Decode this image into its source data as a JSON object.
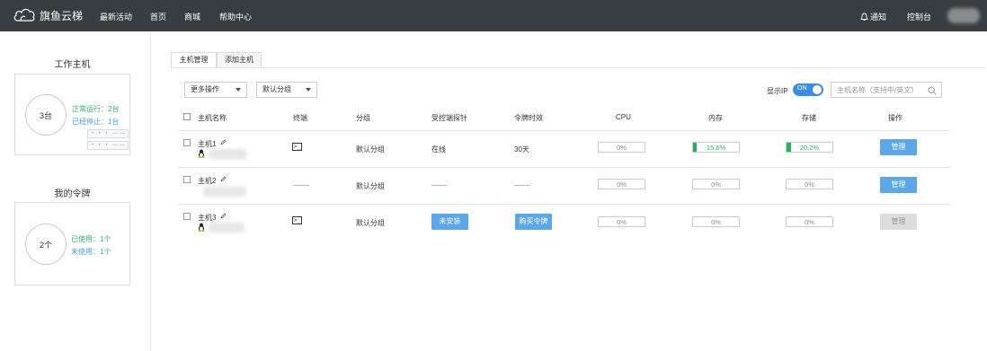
{
  "topbar": {
    "brand": "旗鱼云梯",
    "nav": [
      "最新活动",
      "首页",
      "商城",
      "帮助中心"
    ],
    "notice": "通知",
    "console": "控制台"
  },
  "sidebar": {
    "hosts": {
      "title": "工作主机",
      "count": "3台",
      "running": "正常运行：2台",
      "stopped": "已经停止：1台"
    },
    "tokens": {
      "title": "我的令牌",
      "count": "2个",
      "used": "已使用：1个",
      "unused": "未使用：1个"
    }
  },
  "tabs": [
    "主机管理",
    "添加主机"
  ],
  "toolbar": {
    "more_ops": "更多操作",
    "group": "默认分组",
    "show_ip": "显示IP",
    "toggle": "ON",
    "search_placeholder": "主机名称（支持中/英文）"
  },
  "table": {
    "headers": [
      "主机名称",
      "终端",
      "分组",
      "受控端探针",
      "令牌时效",
      "CPU",
      "内存",
      "存储",
      "操作"
    ],
    "rows": [
      {
        "name": "主机1",
        "group": "默认分组",
        "probe": "在线",
        "token": "30天",
        "cpu": "0%",
        "mem": "15.6%",
        "mem_frac": 0.156,
        "disk": "20.2%",
        "disk_frac": 0.202,
        "op": "管理"
      },
      {
        "name": "主机2",
        "group": "默认分组",
        "cpu": "0%",
        "mem": "0%",
        "disk": "0%",
        "op": "管理"
      },
      {
        "name": "主机3",
        "group": "默认分组",
        "probe_btn": "未安装",
        "token_btn": "购买令牌",
        "cpu": "0%",
        "mem": "0%",
        "disk": "0%",
        "op": "管理"
      }
    ]
  },
  "colors": {
    "topbar": "#373d41",
    "accent": "#3a8ee6",
    "green": "#22b35e",
    "button": "#5aa7ea"
  }
}
